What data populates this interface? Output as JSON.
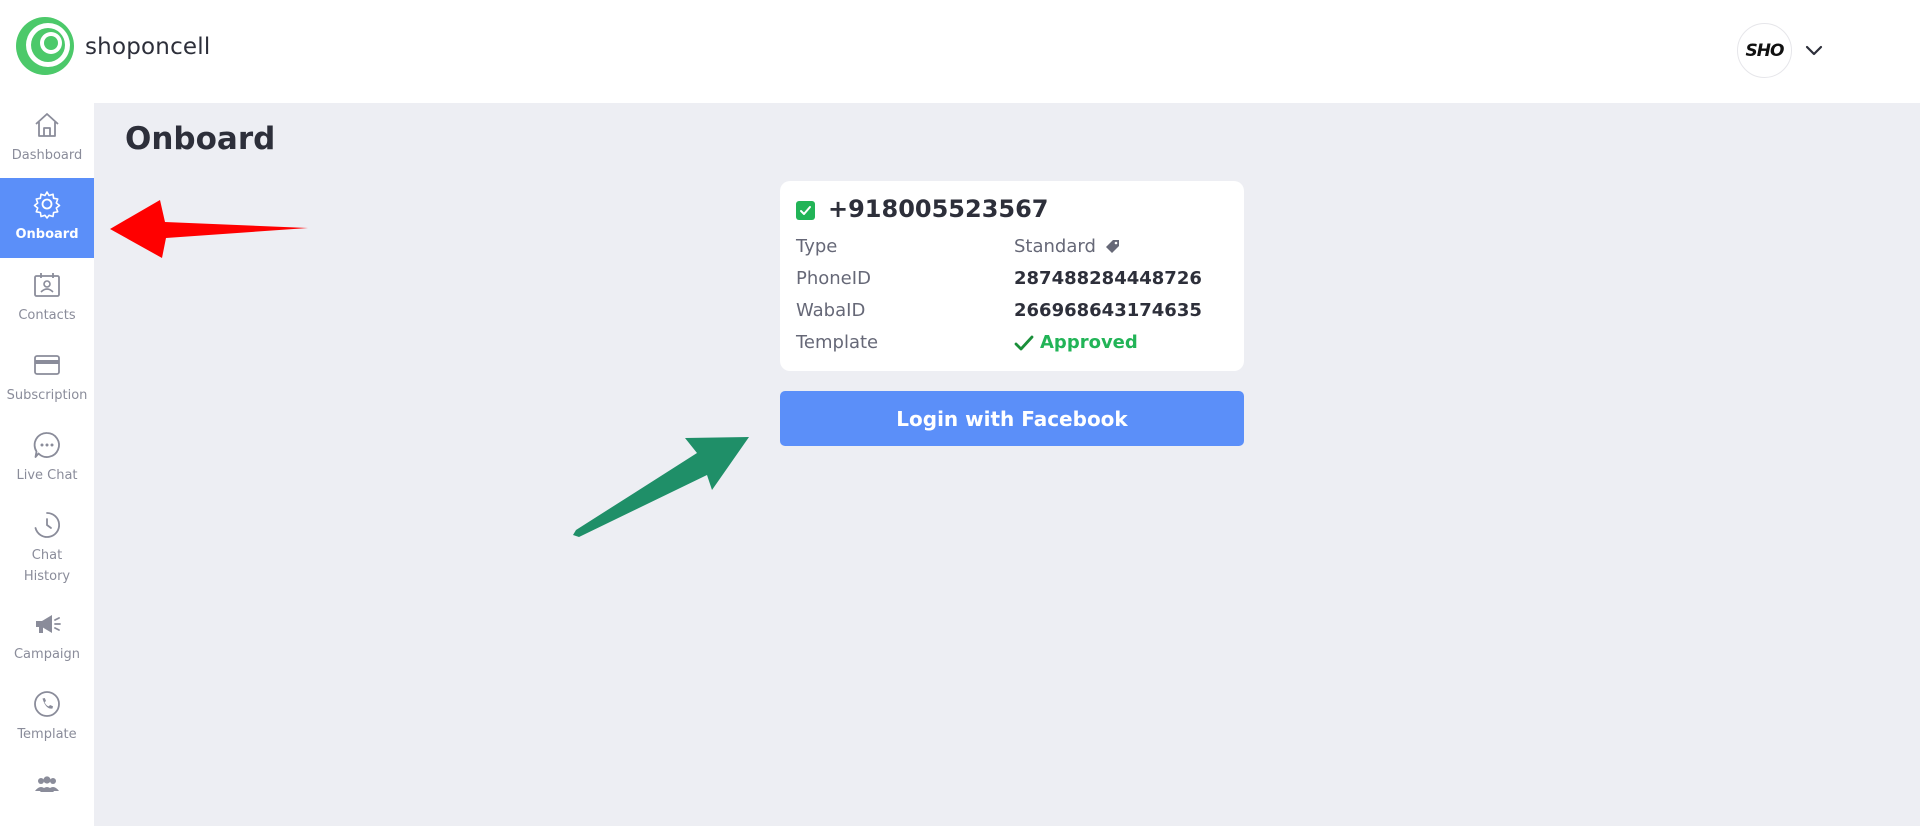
{
  "header": {
    "brand": "shoponcell",
    "avatar_text": "SHO",
    "logo_icon": "shoponcell-logo-icon",
    "dropdown_icon": "chevron-down-icon"
  },
  "sidebar": {
    "items": [
      {
        "label": "Dashboard",
        "icon": "home-icon",
        "active": false
      },
      {
        "label": "Onboard",
        "icon": "gear-icon",
        "active": true
      },
      {
        "label": "Contacts",
        "icon": "contacts-icon",
        "active": false
      },
      {
        "label": "Subscription",
        "icon": "credit-card-icon",
        "active": false
      },
      {
        "label": "Live Chat",
        "icon": "chat-bubble-icon",
        "active": false
      },
      {
        "label": "Chat History",
        "icon": "history-icon",
        "active": false
      },
      {
        "label": "Campaign",
        "icon": "megaphone-icon",
        "active": false
      },
      {
        "label": "Template",
        "icon": "phone-icon",
        "active": false
      },
      {
        "label": "",
        "icon": "users-icon",
        "active": false
      }
    ]
  },
  "main": {
    "title": "Onboard",
    "card": {
      "phone": "+918005523567",
      "rows": [
        {
          "label": "Type",
          "value": "Standard"
        },
        {
          "label": "PhoneID",
          "value": "287488284448726"
        },
        {
          "label": "WabaID",
          "value": "266968643174635"
        },
        {
          "label": "Template",
          "value": "Approved"
        }
      ]
    },
    "login_button": "Login with Facebook"
  },
  "colors": {
    "accent": "#5b8ff9",
    "success": "#22b457",
    "background": "#edeef3",
    "red_arrow": "#ff0000",
    "green_arrow": "#1f8f68"
  }
}
